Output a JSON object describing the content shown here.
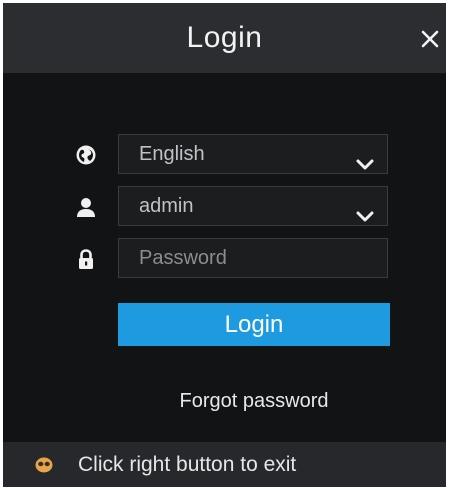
{
  "window": {
    "title": "Login",
    "close_icon": "close-icon"
  },
  "form": {
    "language": {
      "icon": "globe-icon",
      "value": "English"
    },
    "user": {
      "icon": "user-icon",
      "value": "admin"
    },
    "password": {
      "icon": "lock-icon",
      "placeholder": "Password",
      "value": ""
    },
    "login_label": "Login",
    "forgot_label": "Forgot password"
  },
  "status": {
    "icon": "mouse-icon",
    "text": "Click right button to exit"
  },
  "colors": {
    "accent": "#1e9be0",
    "background": "#121314",
    "titlebar": "#2b2d30",
    "statusbar": "#26282b"
  }
}
